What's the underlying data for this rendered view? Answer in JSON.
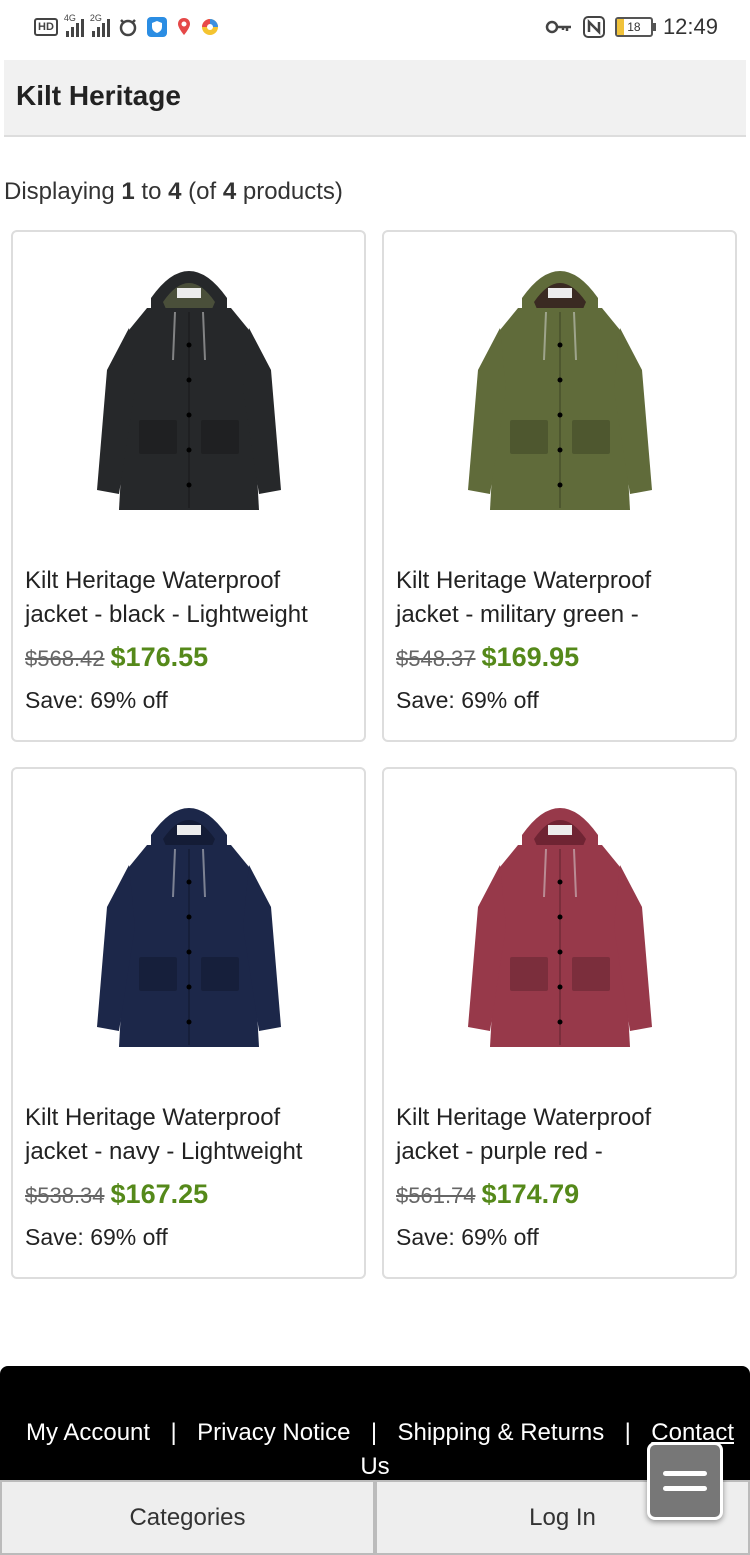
{
  "status_bar": {
    "time": "12:49",
    "battery": "18",
    "network1": "4G",
    "network2": "2G"
  },
  "header": {
    "title": "Kilt Heritage"
  },
  "listing": {
    "prefix": "Displaying",
    "from": "1",
    "to_word": "to",
    "to": "4",
    "of_open": "(of",
    "total": "4",
    "products_close": "products)"
  },
  "products": [
    {
      "name_line1": "Kilt Heritage Waterproof",
      "name_line2": "jacket - black - Lightweight",
      "old_price": "$568.42",
      "new_price": "$176.55",
      "save": "Save: 69% off",
      "color": "#26282a",
      "hood_lining": "#4a4f3a"
    },
    {
      "name_line1": "Kilt Heritage Waterproof",
      "name_line2": "jacket - military green -",
      "old_price": "$548.37",
      "new_price": "$169.95",
      "save": "Save: 69% off",
      "color": "#606b3a",
      "hood_lining": "#3a2a22"
    },
    {
      "name_line1": "Kilt Heritage Waterproof",
      "name_line2": "jacket - navy - Lightweight",
      "old_price": "$538.34",
      "new_price": "$167.25",
      "save": "Save: 69% off",
      "color": "#1c2749",
      "hood_lining": "#141c36"
    },
    {
      "name_line1": "Kilt Heritage Waterproof",
      "name_line2": "jacket - purple red -",
      "old_price": "$561.74",
      "new_price": "$174.79",
      "save": "Save: 69% off",
      "color": "#97394a",
      "hood_lining": "#6f2433"
    }
  ],
  "footer": {
    "links": [
      "My Account",
      "Privacy Notice",
      "Shipping & Returns",
      "Contact"
    ],
    "link_tail": "Us",
    "separator": "|"
  },
  "bottom_nav": {
    "categories": "Categories",
    "login": "Log In"
  }
}
